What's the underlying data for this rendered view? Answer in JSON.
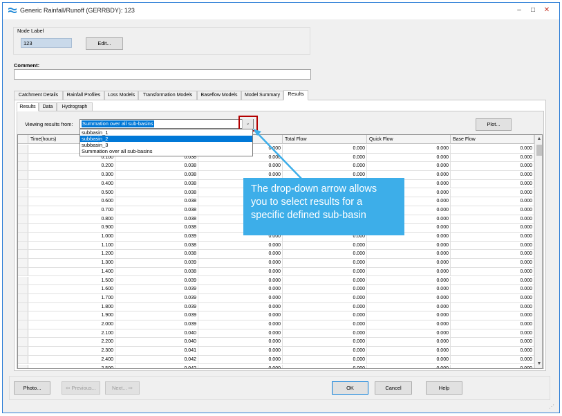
{
  "window": {
    "title": "Generic Rainfall/Runoff (GERRBDY): 123",
    "min_glyph": "–",
    "max_glyph": "□",
    "close_glyph": "✕"
  },
  "node": {
    "label_title": "Node Label",
    "value": "123",
    "edit_button": "Edit..."
  },
  "comment": {
    "label": "Comment:",
    "value": ""
  },
  "tabs": [
    "Catchment Details",
    "Rainfall Profiles",
    "Loss Models",
    "Transformation Models",
    "Baseflow Models",
    "Model Summary",
    "Results"
  ],
  "active_tab": "Results",
  "subtabs": [
    "Results",
    "Data",
    "Hydrograph"
  ],
  "active_subtab": "Results",
  "viewing": {
    "label": "Viewing results from:",
    "selected": "Summation over all sub-basins",
    "arrow_glyph": "⌄",
    "options": [
      "subbasin_1",
      "subbasin_2",
      "subbasin_3",
      "Summation over all sub-basins"
    ],
    "highlighted_option": "subbasin_2"
  },
  "plot_button": "Plot...",
  "grid": {
    "columns": [
      "Time(hours)",
      "",
      "",
      "Total Flow",
      "Quick Flow",
      "Base Flow"
    ],
    "rows": [
      [
        "0.000",
        "",
        "0.000",
        "0.000",
        "0.000",
        "0.000"
      ],
      [
        "0.100",
        "0.038",
        "0.000",
        "0.000",
        "0.000",
        "0.000"
      ],
      [
        "0.200",
        "0.038",
        "0.000",
        "0.000",
        "0.000",
        "0.000"
      ],
      [
        "0.300",
        "0.038",
        "0.000",
        "0.000",
        "0.000",
        "0.000"
      ],
      [
        "0.400",
        "0.038",
        "0.000",
        "0.000",
        "0.000",
        "0.000"
      ],
      [
        "0.500",
        "0.038",
        "0.000",
        "0.000",
        "0.000",
        "0.000"
      ],
      [
        "0.600",
        "0.038",
        "0.000",
        "0.000",
        "0.000",
        "0.000"
      ],
      [
        "0.700",
        "0.038",
        "0.000",
        "0.000",
        "0.000",
        "0.000"
      ],
      [
        "0.800",
        "0.038",
        "0.000",
        "0.000",
        "0.000",
        "0.000"
      ],
      [
        "0.900",
        "0.038",
        "0.000",
        "0.000",
        "0.000",
        "0.000"
      ],
      [
        "1.000",
        "0.039",
        "0.000",
        "0.000",
        "0.000",
        "0.000"
      ],
      [
        "1.100",
        "0.038",
        "0.000",
        "0.000",
        "0.000",
        "0.000"
      ],
      [
        "1.200",
        "0.038",
        "0.000",
        "0.000",
        "0.000",
        "0.000"
      ],
      [
        "1.300",
        "0.039",
        "0.000",
        "0.000",
        "0.000",
        "0.000"
      ],
      [
        "1.400",
        "0.038",
        "0.000",
        "0.000",
        "0.000",
        "0.000"
      ],
      [
        "1.500",
        "0.039",
        "0.000",
        "0.000",
        "0.000",
        "0.000"
      ],
      [
        "1.600",
        "0.039",
        "0.000",
        "0.000",
        "0.000",
        "0.000"
      ],
      [
        "1.700",
        "0.039",
        "0.000",
        "0.000",
        "0.000",
        "0.000"
      ],
      [
        "1.800",
        "0.039",
        "0.000",
        "0.000",
        "0.000",
        "0.000"
      ],
      [
        "1.900",
        "0.039",
        "0.000",
        "0.000",
        "0.000",
        "0.000"
      ],
      [
        "2.000",
        "0.039",
        "0.000",
        "0.000",
        "0.000",
        "0.000"
      ],
      [
        "2.100",
        "0.040",
        "0.000",
        "0.000",
        "0.000",
        "0.000"
      ],
      [
        "2.200",
        "0.040",
        "0.000",
        "0.000",
        "0.000",
        "0.000"
      ],
      [
        "2.300",
        "0.041",
        "0.000",
        "0.000",
        "0.000",
        "0.000"
      ],
      [
        "2.400",
        "0.042",
        "0.000",
        "0.000",
        "0.000",
        "0.000"
      ],
      [
        "2.500",
        "0.042",
        "0.000",
        "0.000",
        "0.000",
        "0.000"
      ]
    ]
  },
  "callout": {
    "lines": [
      "The drop-down arrow allows",
      "you to select results for a",
      "specific defined sub-basin"
    ],
    "color": "#3daee9"
  },
  "highlight_color": "#b30000",
  "buttons": {
    "photo": "Photo...",
    "previous": "Previous...",
    "next": "Next...",
    "ok": "OK",
    "cancel": "Cancel",
    "help": "Help"
  }
}
